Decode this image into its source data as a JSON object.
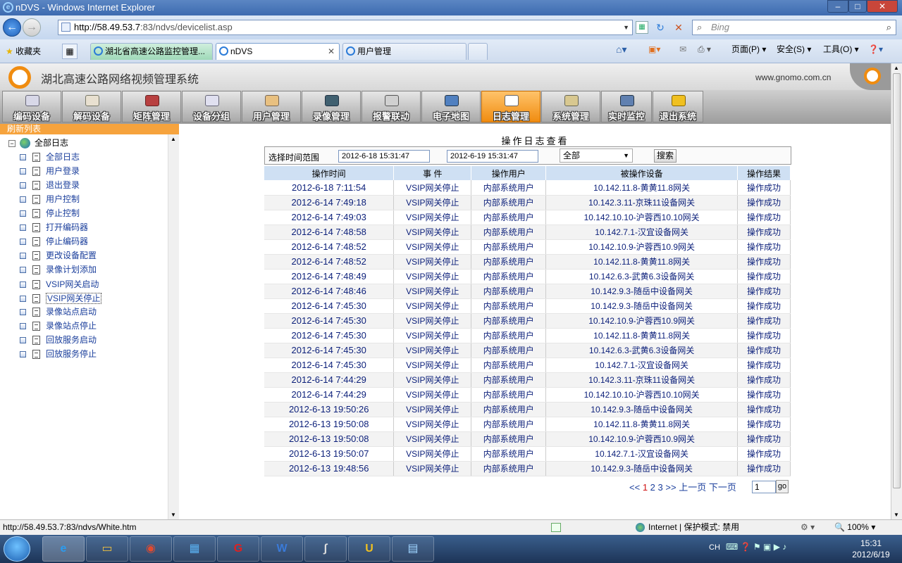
{
  "browser": {
    "window_title": "nDVS - Windows Internet Explorer",
    "window_buttons": [
      "–",
      "□",
      "✕"
    ],
    "url_host": "http://58.49.53.7",
    "url_rest": ":83/ndvs/devicelist.asp",
    "search_placeholder": "Bing",
    "favorites_label": "收藏夹",
    "tabs": [
      {
        "label": "湖北省高速公路监控管理..."
      },
      {
        "label": "nDVS"
      },
      {
        "label": "用户管理"
      }
    ],
    "commands": {
      "page": "页面(P)",
      "safety": "安全(S)",
      "tools": "工具(O)"
    },
    "status_url": "http://58.49.53.7:83/ndvs/White.htm",
    "status_zone": "Internet | 保护模式: 禁用",
    "zoom": "100%"
  },
  "app": {
    "title": "湖北高速公路网络视频管理系统",
    "site": "www.gnomo.com.cn",
    "menu": [
      {
        "label": "编码设备",
        "icon": "encoder-icon"
      },
      {
        "label": "解码设备",
        "icon": "decoder-icon"
      },
      {
        "label": "矩阵管理",
        "icon": "matrix-icon"
      },
      {
        "label": "设备分组",
        "icon": "device-group-icon"
      },
      {
        "label": "用户管理",
        "icon": "users-icon"
      },
      {
        "label": "录像管理",
        "icon": "recording-icon"
      },
      {
        "label": "报警联动",
        "icon": "alarm-icon"
      },
      {
        "label": "电子地图",
        "icon": "map-icon"
      },
      {
        "label": "日志管理",
        "icon": "log-icon",
        "active": true
      },
      {
        "label": "系统管理",
        "icon": "settings-icon"
      },
      {
        "label": "实时监控",
        "icon": "monitor-icon"
      },
      {
        "label": "退出系统",
        "icon": "exit-icon"
      }
    ],
    "accent": "#f08c10"
  },
  "sidebar": {
    "header": "刷新列表",
    "root": "全部日志",
    "items": [
      {
        "label": "全部日志"
      },
      {
        "label": "用户登录"
      },
      {
        "label": "退出登录"
      },
      {
        "label": "用户控制"
      },
      {
        "label": "停止控制"
      },
      {
        "label": "打开编码器"
      },
      {
        "label": "停止编码器"
      },
      {
        "label": "更改设备配置"
      },
      {
        "label": "录像计划添加"
      },
      {
        "label": "VSIP网关启动"
      },
      {
        "label": "VSIP网关停止",
        "selected": true
      },
      {
        "label": "录像站点启动"
      },
      {
        "label": "录像站点停止"
      },
      {
        "label": "回放服务启动"
      },
      {
        "label": "回放服务停止"
      }
    ]
  },
  "main": {
    "title": "操作日志查看",
    "filter_label": "选择时间范围",
    "start_time": "2012-6-18 15:31:47",
    "end_time": "2012-6-19 15:31:47",
    "type_select": "全部",
    "search_button": "搜索",
    "columns": [
      "操作时间",
      "事 件",
      "操作用户",
      "被操作设备",
      "操作结果"
    ],
    "rows": [
      [
        "2012-6-18 7:11:54",
        "VSIP网关停止",
        "内部系统用户",
        "10.142.11.8-黄黄11.8网关",
        "操作成功"
      ],
      [
        "2012-6-14 7:49:18",
        "VSIP网关停止",
        "内部系统用户",
        "10.142.3.11-京珠11设备网关",
        "操作成功"
      ],
      [
        "2012-6-14 7:49:03",
        "VSIP网关停止",
        "内部系统用户",
        "10.142.10.10-沪蓉西10.10网关",
        "操作成功"
      ],
      [
        "2012-6-14 7:48:58",
        "VSIP网关停止",
        "内部系统用户",
        "10.142.7.1-汉宜设备网关",
        "操作成功"
      ],
      [
        "2012-6-14 7:48:52",
        "VSIP网关停止",
        "内部系统用户",
        "10.142.10.9-沪蓉西10.9网关",
        "操作成功"
      ],
      [
        "2012-6-14 7:48:52",
        "VSIP网关停止",
        "内部系统用户",
        "10.142.11.8-黄黄11.8网关",
        "操作成功"
      ],
      [
        "2012-6-14 7:48:49",
        "VSIP网关停止",
        "内部系统用户",
        "10.142.6.3-武黄6.3设备网关",
        "操作成功"
      ],
      [
        "2012-6-14 7:48:46",
        "VSIP网关停止",
        "内部系统用户",
        "10.142.9.3-随岳中设备网关",
        "操作成功"
      ],
      [
        "2012-6-14 7:45:30",
        "VSIP网关停止",
        "内部系统用户",
        "10.142.9.3-随岳中设备网关",
        "操作成功"
      ],
      [
        "2012-6-14 7:45:30",
        "VSIP网关停止",
        "内部系统用户",
        "10.142.10.9-沪蓉西10.9网关",
        "操作成功"
      ],
      [
        "2012-6-14 7:45:30",
        "VSIP网关停止",
        "内部系统用户",
        "10.142.11.8-黄黄11.8网关",
        "操作成功"
      ],
      [
        "2012-6-14 7:45:30",
        "VSIP网关停止",
        "内部系统用户",
        "10.142.6.3-武黄6.3设备网关",
        "操作成功"
      ],
      [
        "2012-6-14 7:45:30",
        "VSIP网关停止",
        "内部系统用户",
        "10.142.7.1-汉宜设备网关",
        "操作成功"
      ],
      [
        "2012-6-14 7:44:29",
        "VSIP网关停止",
        "内部系统用户",
        "10.142.3.11-京珠11设备网关",
        "操作成功"
      ],
      [
        "2012-6-14 7:44:29",
        "VSIP网关停止",
        "内部系统用户",
        "10.142.10.10-沪蓉西10.10网关",
        "操作成功"
      ],
      [
        "2012-6-13 19:50:26",
        "VSIP网关停止",
        "内部系统用户",
        "10.142.9.3-随岳中设备网关",
        "操作成功"
      ],
      [
        "2012-6-13 19:50:08",
        "VSIP网关停止",
        "内部系统用户",
        "10.142.11.8-黄黄11.8网关",
        "操作成功"
      ],
      [
        "2012-6-13 19:50:08",
        "VSIP网关停止",
        "内部系统用户",
        "10.142.10.9-沪蓉西10.9网关",
        "操作成功"
      ],
      [
        "2012-6-13 19:50:07",
        "VSIP网关停止",
        "内部系统用户",
        "10.142.7.1-汉宜设备网关",
        "操作成功"
      ],
      [
        "2012-6-13 19:48:56",
        "VSIP网关停止",
        "内部系统用户",
        "10.142.9.3-随岳中设备网关",
        "操作成功"
      ]
    ],
    "pager": {
      "first": "<<",
      "pages": [
        "1",
        "2",
        "3"
      ],
      "current": "1",
      "last": ">>",
      "prev": "上一页",
      "next": "下一页",
      "input": "1",
      "go": "go"
    }
  },
  "taskbar": {
    "time": "15:31",
    "date": "2012/6/19",
    "lang": "CH"
  }
}
